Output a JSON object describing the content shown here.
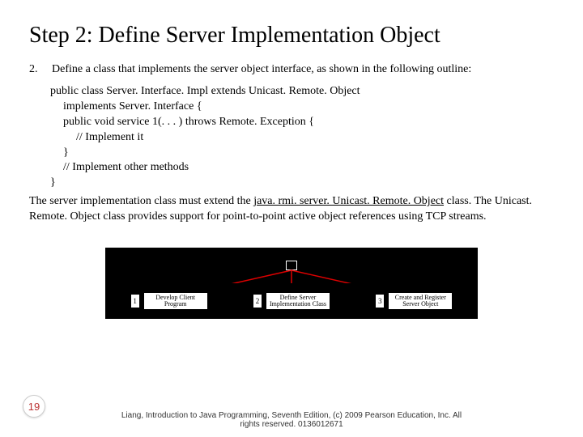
{
  "title": "Step 2: Define Server Implementation Object",
  "list_number": "2.",
  "list_text": "Define a class that implements the server object interface, as shown in the following outline:",
  "code": {
    "l1": "public class Server. Interface. Impl extends Unicast. Remote. Object",
    "l2": "implements Server. Interface {",
    "l3": "public void service 1(. . . ) throws Remote. Exception {",
    "l4": "// Implement it",
    "l5": "}",
    "l6": "// Implement other methods",
    "l7": "}"
  },
  "para_pre": "The server implementation class must extend the ",
  "para_link": "java. rmi. server. Unicast. Remote. Object",
  "para_post": " class. The Unicast. Remote. Object class provides support for point-to-point active object references using TCP streams.",
  "diagram": {
    "items": [
      {
        "num": "1",
        "label_l1": "Develop Client",
        "label_l2": "Program"
      },
      {
        "num": "2",
        "label_l1": "Define Server",
        "label_l2": "Implementation Class"
      },
      {
        "num": "3",
        "label_l1": "Create and Register",
        "label_l2": "Server Object"
      }
    ]
  },
  "page_number": "19",
  "footer_l1": "Liang, Introduction to Java Programming, Seventh Edition, (c) 2009 Pearson Education, Inc. All",
  "footer_l2": "rights reserved. 0136012671"
}
